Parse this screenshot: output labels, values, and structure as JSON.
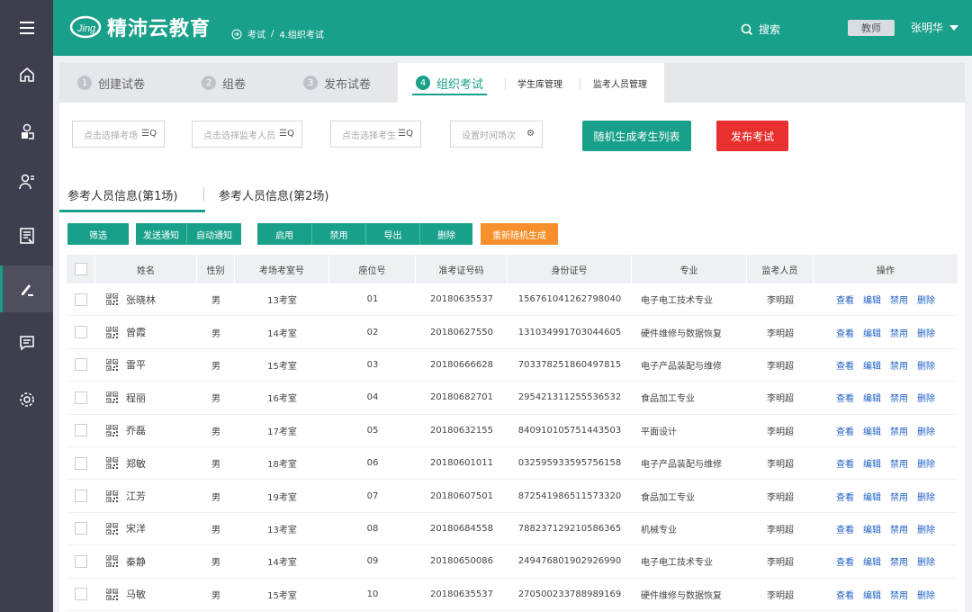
{
  "colors": {
    "primary": "#19a08a",
    "sidebar": "#3d3f4e",
    "danger": "#e8302f",
    "warning": "#f7902c",
    "link": "#1f60c4"
  },
  "sidebar": {
    "items": [
      {
        "icon": "menu-icon"
      },
      {
        "icon": "home-icon"
      },
      {
        "icon": "user-group-icon"
      },
      {
        "icon": "user-list-icon"
      },
      {
        "icon": "document-icon"
      },
      {
        "icon": "pen-icon",
        "active": true
      },
      {
        "icon": "message-icon"
      },
      {
        "icon": "gear-icon"
      }
    ]
  },
  "header": {
    "logo_text": "精沛云教育",
    "breadcrumb": [
      "考试",
      "/",
      "4.组织考试"
    ],
    "search_label": "搜索",
    "role": "教师",
    "user_name": "张明华"
  },
  "steps": [
    {
      "num": "1",
      "label": "创建试卷"
    },
    {
      "num": "2",
      "label": "组卷"
    },
    {
      "num": "3",
      "label": "发布试卷"
    },
    {
      "num": "4",
      "label": "组织考试"
    }
  ],
  "subtabs": [
    "学生库管理",
    "监考人员管理"
  ],
  "selectors": {
    "room": "点击选择考场",
    "proctor": "点击选择监考人员",
    "student": "点击选择考生",
    "time": "设置时间场次"
  },
  "buttons": {
    "random_list": "随机生成考生列表",
    "publish": "发布考试",
    "filter": "筛选",
    "send_notice": "发送通知",
    "auto_notice": "自动通知",
    "enable": "启用",
    "disable": "禁用",
    "export": "导出",
    "delete": "删除",
    "regenerate": "重新随机生成"
  },
  "info_tabs": [
    "参考人员信息(第1场)",
    "参考人员信息(第2场)"
  ],
  "table": {
    "headers": [
      "姓名",
      "性别",
      "考场考室号",
      "座位号",
      "准考证号码",
      "身份证号",
      "专业",
      "监考人员",
      "操作"
    ],
    "ops": [
      "查看",
      "编辑",
      "禁用",
      "删除"
    ],
    "rows": [
      {
        "name": "张晓林",
        "sex": "男",
        "room": "13考室",
        "seat": "01",
        "exam_no": "20180635537",
        "id_no": "156761041262798040",
        "major": "电子电工技术专业",
        "proctor": "李明超"
      },
      {
        "name": "曾霞",
        "sex": "男",
        "room": "14考室",
        "seat": "02",
        "exam_no": "20180627550",
        "id_no": "131034991703044605",
        "major": "硬件维修与数据恢复",
        "proctor": "李明超"
      },
      {
        "name": "雷平",
        "sex": "男",
        "room": "15考室",
        "seat": "03",
        "exam_no": "20180666628",
        "id_no": "703378251860497815",
        "major": "电子产品装配与维修",
        "proctor": "李明超"
      },
      {
        "name": "程丽",
        "sex": "男",
        "room": "16考室",
        "seat": "04",
        "exam_no": "20180682701",
        "id_no": "295421311255536532",
        "major": "食品加工专业",
        "proctor": "李明超"
      },
      {
        "name": "乔磊",
        "sex": "男",
        "room": "17考室",
        "seat": "05",
        "exam_no": "20180632155",
        "id_no": "840910105751443503",
        "major": "平面设计",
        "proctor": "李明超"
      },
      {
        "name": "郑敏",
        "sex": "男",
        "room": "18考室",
        "seat": "06",
        "exam_no": "20180601011",
        "id_no": "032595933595756158",
        "major": "电子产品装配与维修",
        "proctor": "李明超"
      },
      {
        "name": "江芳",
        "sex": "男",
        "room": "19考室",
        "seat": "07",
        "exam_no": "20180607501",
        "id_no": "872541986511573320",
        "major": "食品加工专业",
        "proctor": "李明超"
      },
      {
        "name": "宋洋",
        "sex": "男",
        "room": "13考室",
        "seat": "08",
        "exam_no": "20180684558",
        "id_no": "788237129210586365",
        "major": "机械专业",
        "proctor": "李明超"
      },
      {
        "name": "秦静",
        "sex": "男",
        "room": "14考室",
        "seat": "09",
        "exam_no": "20180650086",
        "id_no": "249476801902926990",
        "major": "电子电工技术专业",
        "proctor": "李明超"
      },
      {
        "name": "马敏",
        "sex": "男",
        "room": "15考室",
        "seat": "10",
        "exam_no": "20180635537",
        "id_no": "270500233788989169",
        "major": "硬件维修与数据恢复",
        "proctor": "李明超"
      }
    ]
  }
}
